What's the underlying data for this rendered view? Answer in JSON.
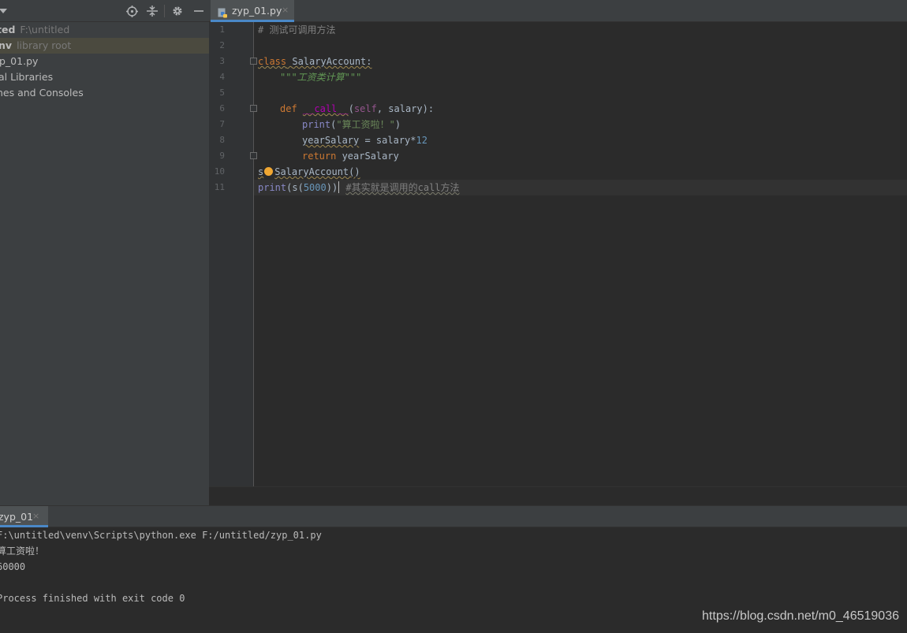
{
  "project_panel": {
    "toolbar_icons": [
      "dropdown-arrow-icon",
      "locate-icon",
      "collapse-icon",
      "gear-icon",
      "minimize-icon"
    ],
    "tree": [
      {
        "label": "ted",
        "hint": "F:\\untitled",
        "bold": true
      },
      {
        "label": "nv",
        "hint": "library root",
        "bold": true,
        "selected": true
      },
      {
        "label": "p_01.py",
        "hint": ""
      },
      {
        "label": "al Libraries",
        "hint": ""
      },
      {
        "label": "hes and Consoles",
        "hint": ""
      }
    ]
  },
  "editor": {
    "tab": {
      "label": "zyp_01.py",
      "close": "×",
      "icon": "python-file-icon"
    },
    "line_numbers": [
      "1",
      "2",
      "3",
      "4",
      "5",
      "6",
      "7",
      "8",
      "9",
      "10",
      "11"
    ],
    "code": {
      "l1": "# 测试可调用方法",
      "l3_kw": "class",
      "l3_name": "SalaryAccount:",
      "l4": "\"\"\"工资类计算\"\"\"",
      "l6_kw": "def",
      "l6_name": "__call__",
      "l6_open": "(",
      "l6_self": "self",
      "l6_rest": ", salary):",
      "l7_fn": "print",
      "l7_open": "(",
      "l7_str": "\"算工资啦！\"",
      "l7_close": ")",
      "l8_var": "yearSalary",
      "l8_rest": " = salary*",
      "l8_num": "12",
      "l9_kw": "return",
      "l9_rest": " yearSalary",
      "l10_var": "s",
      "l10_rest": "SalaryAccount()",
      "l11_fn": "print",
      "l11_open": "(s(",
      "l11_num": "5000",
      "l11_close": "))",
      "l11_cmt": "#其实就是调用的call方法"
    }
  },
  "run_panel": {
    "tab": {
      "label": "zyp_01",
      "close": "×"
    },
    "console": [
      "F:\\untitled\\venv\\Scripts\\python.exe F:/untitled/zyp_01.py",
      "算工资啦！",
      "60000",
      "",
      "Process finished with exit code 0"
    ]
  },
  "watermark": "https://blog.csdn.net/m0_46519036"
}
